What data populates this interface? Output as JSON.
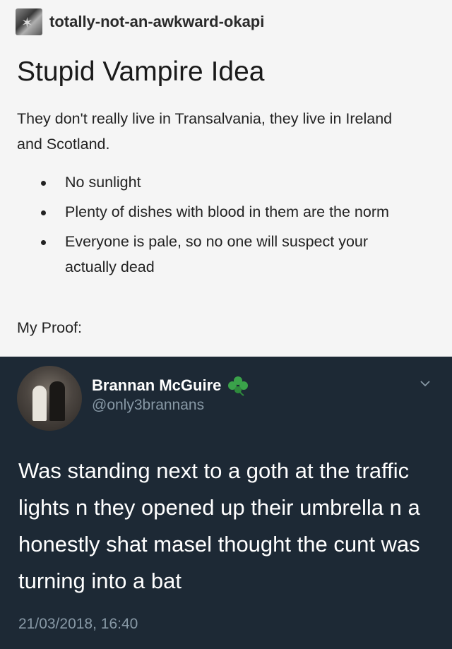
{
  "post": {
    "username": "totally-not-an-awkward-okapi",
    "title": "Stupid Vampire Idea",
    "intro": "They don't really live in Transalvania, they live in Ireland and Scotland.",
    "bullets": [
      "No sunlight",
      "Plenty of dishes with blood in them are the norm",
      "Everyone is pale, so no one will suspect your actually dead"
    ],
    "proof_label": "My Proof:"
  },
  "tweet": {
    "name": "Brannan McGuire",
    "handle": "@only3brannans",
    "text": "Was standing next to a goth at the traffic lights n they opened up their umbrella n a honestly shat masel thought the cunt was turning into a bat",
    "date": "21/03/2018, 16:40",
    "name_emoji": "clover-icon",
    "colors": {
      "background": "#1d2935",
      "secondary_text": "#8899a6",
      "clover": "#3aa24a"
    }
  }
}
